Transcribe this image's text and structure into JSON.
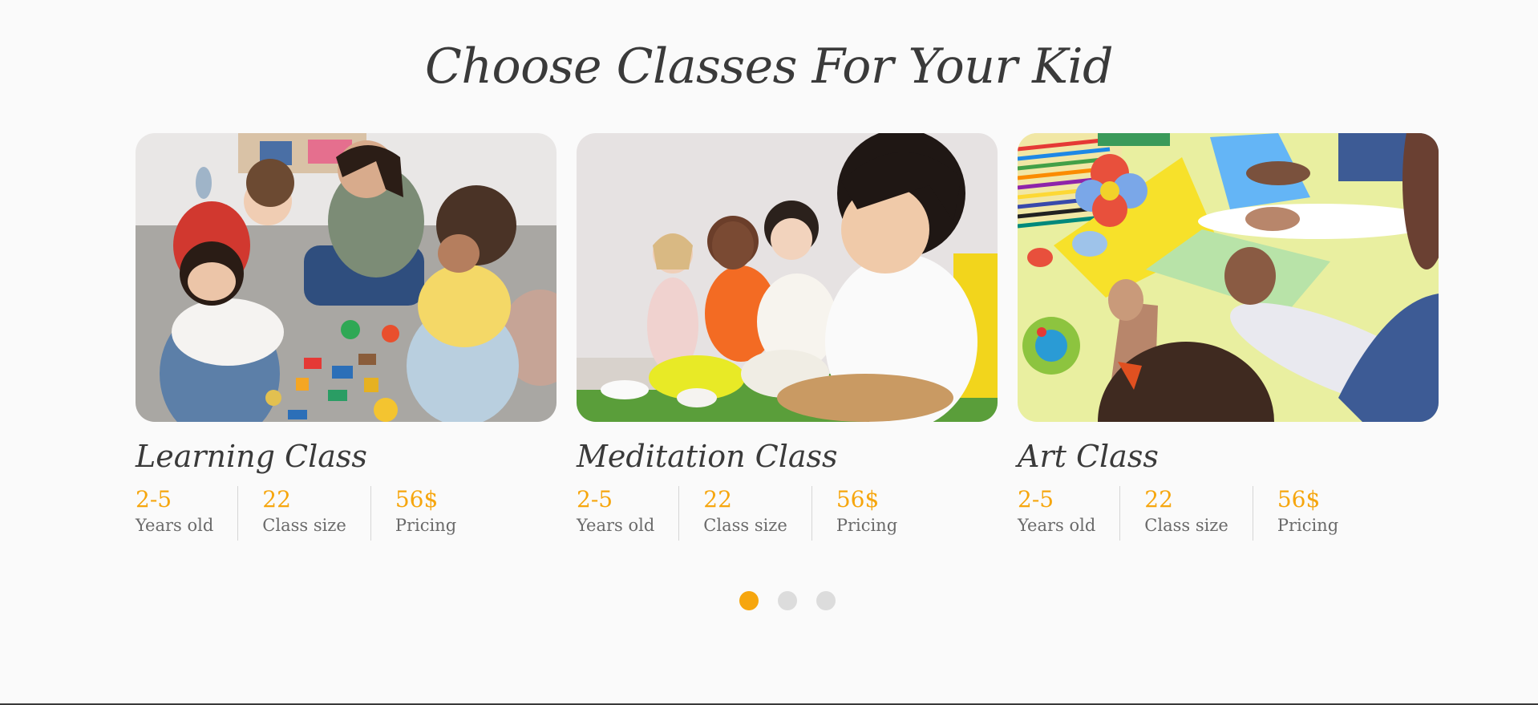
{
  "section": {
    "title": "Choose Classes For Your Kid"
  },
  "colors": {
    "accent": "#f6a60e",
    "heading": "#3a3a3a",
    "muted": "#6a6a6a",
    "background": "#fafafa"
  },
  "cards": [
    {
      "title": "Learning Class",
      "stats": [
        {
          "value": "2-5",
          "label": "Years old"
        },
        {
          "value": "22",
          "label": "Class size"
        },
        {
          "value": "56$",
          "label": "Pricing"
        }
      ]
    },
    {
      "title": "Meditation Class",
      "stats": [
        {
          "value": "2-5",
          "label": "Years old"
        },
        {
          "value": "22",
          "label": "Class size"
        },
        {
          "value": "56$",
          "label": "Pricing"
        }
      ]
    },
    {
      "title": "Art Class",
      "stats": [
        {
          "value": "2-5",
          "label": "Years old"
        },
        {
          "value": "22",
          "label": "Class size"
        },
        {
          "value": "56$",
          "label": "Pricing"
        }
      ]
    }
  ],
  "carousel": {
    "active_index": 0,
    "total": 3
  }
}
